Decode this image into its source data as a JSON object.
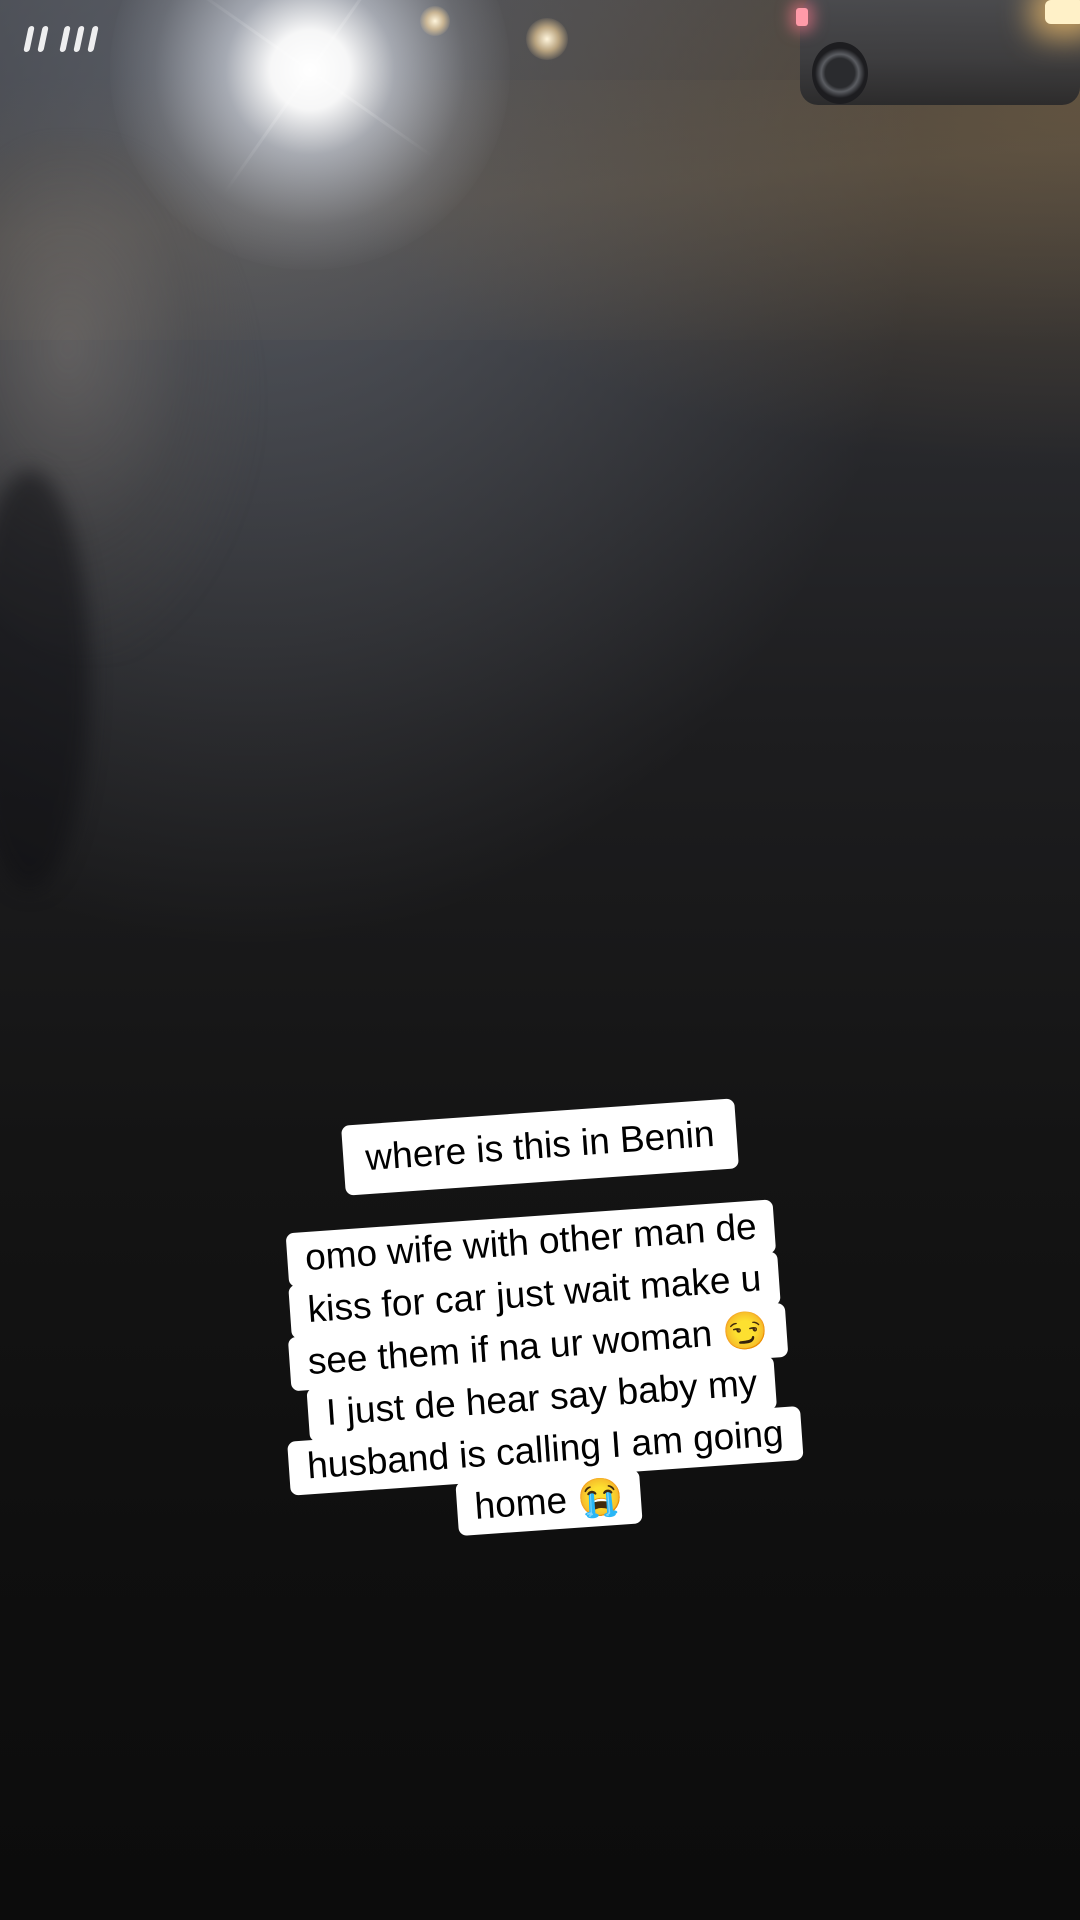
{
  "captions": {
    "question": "where is this in Benin",
    "story_lines": [
      "omo wife with other man de",
      "kiss for car just wait make u",
      "see them if na ur woman 😏",
      "I just de hear say baby my",
      "husband is calling I am going",
      "home 😭"
    ]
  }
}
